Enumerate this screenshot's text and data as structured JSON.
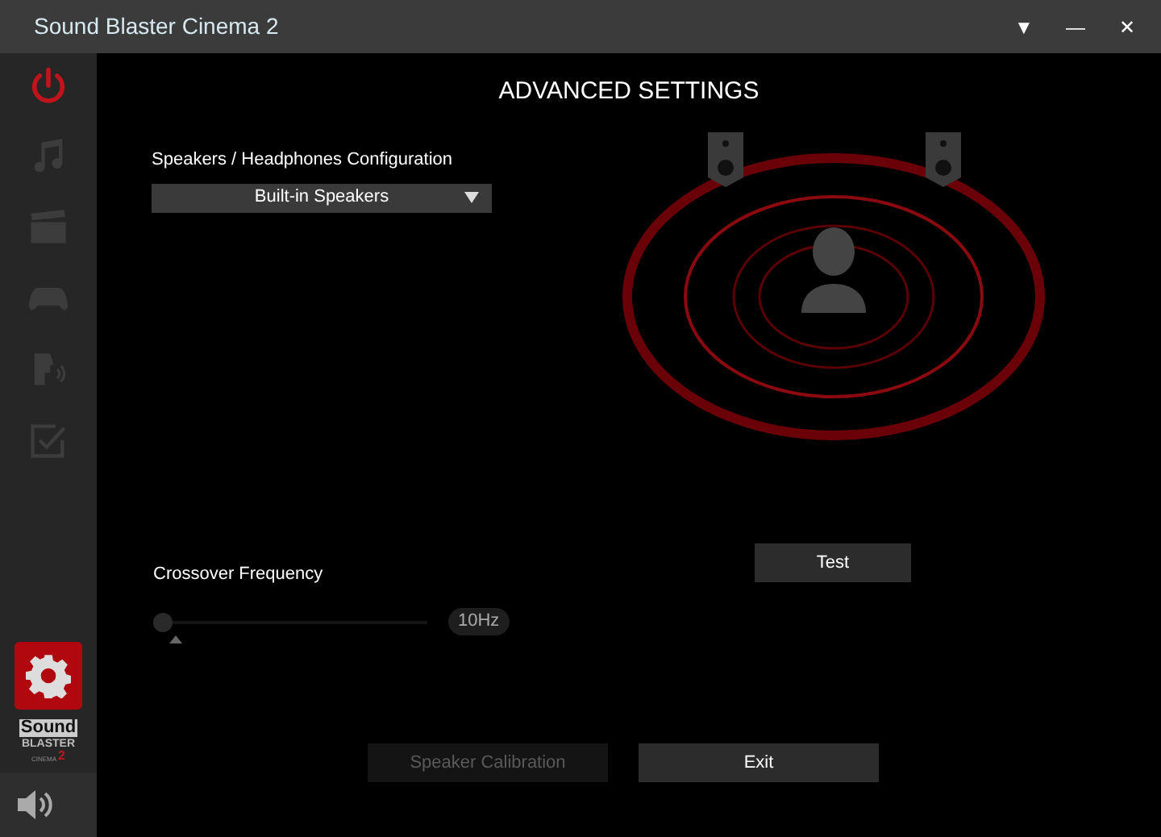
{
  "window": {
    "title": "Sound Blaster Cinema 2",
    "controls": [
      "▼",
      "—",
      "✕"
    ]
  },
  "sidebar": {
    "items": [
      {
        "kind": "power",
        "selected": true
      },
      {
        "kind": "music",
        "selected": false
      },
      {
        "kind": "movie",
        "selected": false
      },
      {
        "kind": "game",
        "selected": false
      },
      {
        "kind": "voice",
        "selected": false
      },
      {
        "kind": "check",
        "selected": false
      }
    ],
    "settings": {
      "selected": true
    },
    "logo": {
      "line_1": "Sound",
      "line_2": "BLASTER",
      "line_3": "CINEMA",
      "line_4": "2"
    }
  },
  "heading": "ADVANCED SETTINGS",
  "config": {
    "label": "Speakers / Headphones Configuration",
    "value": "Built-in Speakers"
  },
  "test_button": {
    "label": "Test",
    "disabled": false
  },
  "crossover": {
    "label": "Crossover Frequency",
    "level": 0,
    "reading": "10Hz"
  },
  "buttons": [
    {
      "label": "Speaker Calibration",
      "disabled": true
    },
    {
      "label": "Exit",
      "disabled": false
    }
  ]
}
